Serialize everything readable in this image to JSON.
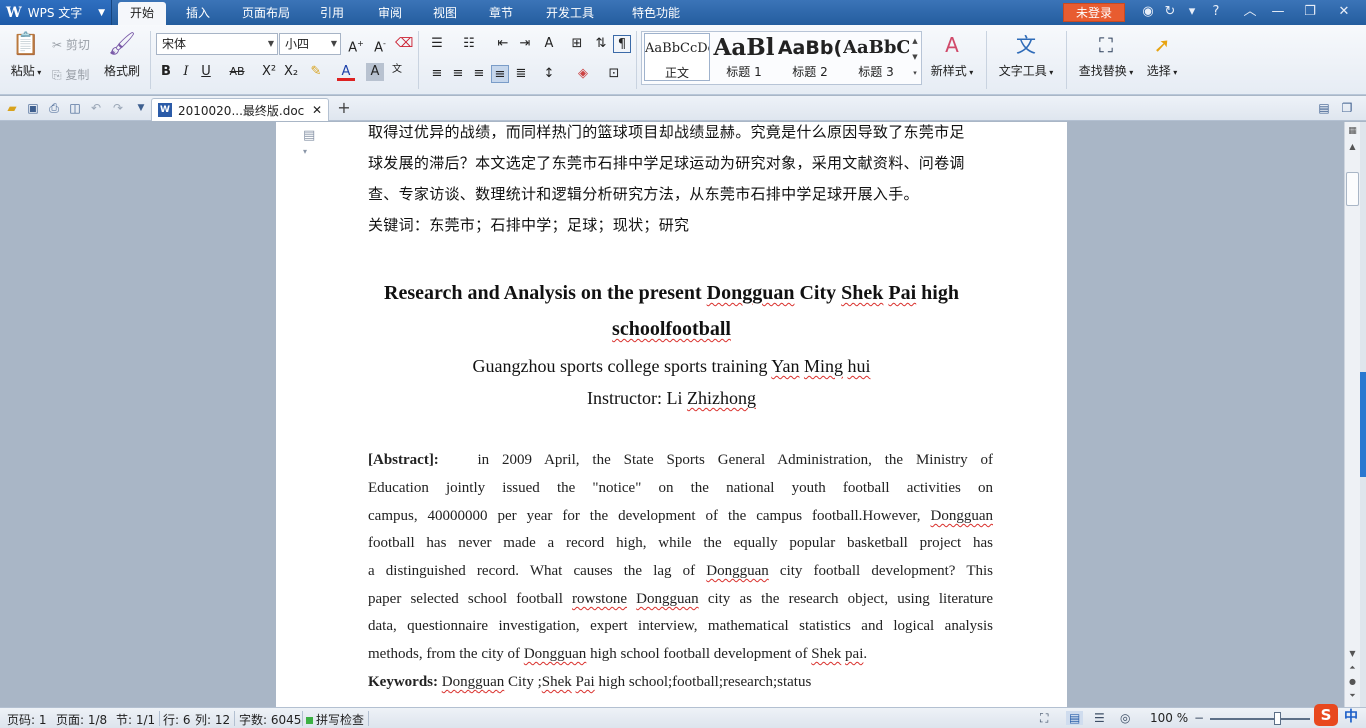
{
  "titlebar": {
    "app_name": "WPS 文字",
    "tabs": [
      "开始",
      "插入",
      "页面布局",
      "引用",
      "审阅",
      "视图",
      "章节",
      "开发工具",
      "特色功能"
    ],
    "login": "未登录"
  },
  "ribbon": {
    "paste": "粘贴",
    "cut": "剪切",
    "copy": "复制",
    "format_painter": "格式刷",
    "font_name": "宋体",
    "font_size": "小四",
    "styles": [
      {
        "sample": "AaBbCcDd",
        "name": "正文"
      },
      {
        "sample": "AaBl",
        "name": "标题 1"
      },
      {
        "sample": "AaBb(",
        "name": "标题 2"
      },
      {
        "sample": "AaBbC",
        "name": "标题 3"
      }
    ],
    "new_style": "新样式",
    "text_tools": "文字工具",
    "find_replace": "查找替换",
    "select": "选择"
  },
  "tabbar": {
    "doc_name": "2010020...最终版.doc"
  },
  "document": {
    "cn_lines": [
      "取得过优异的战绩，而同样热门的篮球项目却战绩显赫。究竟是什么原因导致了东莞市足",
      "球发展的滞后？本文选定了东莞市石排中学足球运动为研究对象，采用文献资料、问卷调",
      "查、专家访谈、数理统计和逻辑分析研究方法，从东莞市石排中学足球开展入手。",
      "关键词：东莞市；石排中学；足球；现状；研究"
    ],
    "title_line1": "Research and Analysis on the present Dongguan City Shek Pai high",
    "title_line2": "schoolfootball",
    "author_line": "Guangzhou sports college sports training Yan Ming hui",
    "instructor_line": "Instructor: Li Zhizhong",
    "abstract_label": "[Abstract]:",
    "abstract_lines": [
      "in 2009 April, the State Sports General Administration, the Ministry of",
      "Education jointly issued the \"notice\" on the national youth football activities on",
      "campus, 40000000 per year for the development of the campus football.However, Dongguan",
      "football has never made a record high, while the equally popular basketball project has",
      "a distinguished record. What causes the lag of Dongguan city football development? This",
      "paper selected school football rowstone Dongguan city as the research object, using literature",
      "data, questionnaire investigation, expert interview, mathematical statistics and logical analysis",
      "methods, from the city of Dongguan high school football development of Shek pai."
    ],
    "keywords_label": "Keywords:",
    "keywords_text": "Dongguan City ;Shek Pai high school;football;research;status"
  },
  "statusbar": {
    "page_code": "页码: 1",
    "page": "页面: 1/8",
    "section": "节: 1/1",
    "row": "行: 6",
    "col": "列: 12",
    "word_count": "字数: 6045",
    "spell_check": "拼写检查",
    "zoom": "100 %",
    "ime": "中"
  },
  "colors": {
    "accent": "#2a78d0",
    "login": "#e85c30",
    "spell_error": "#d9302c"
  }
}
